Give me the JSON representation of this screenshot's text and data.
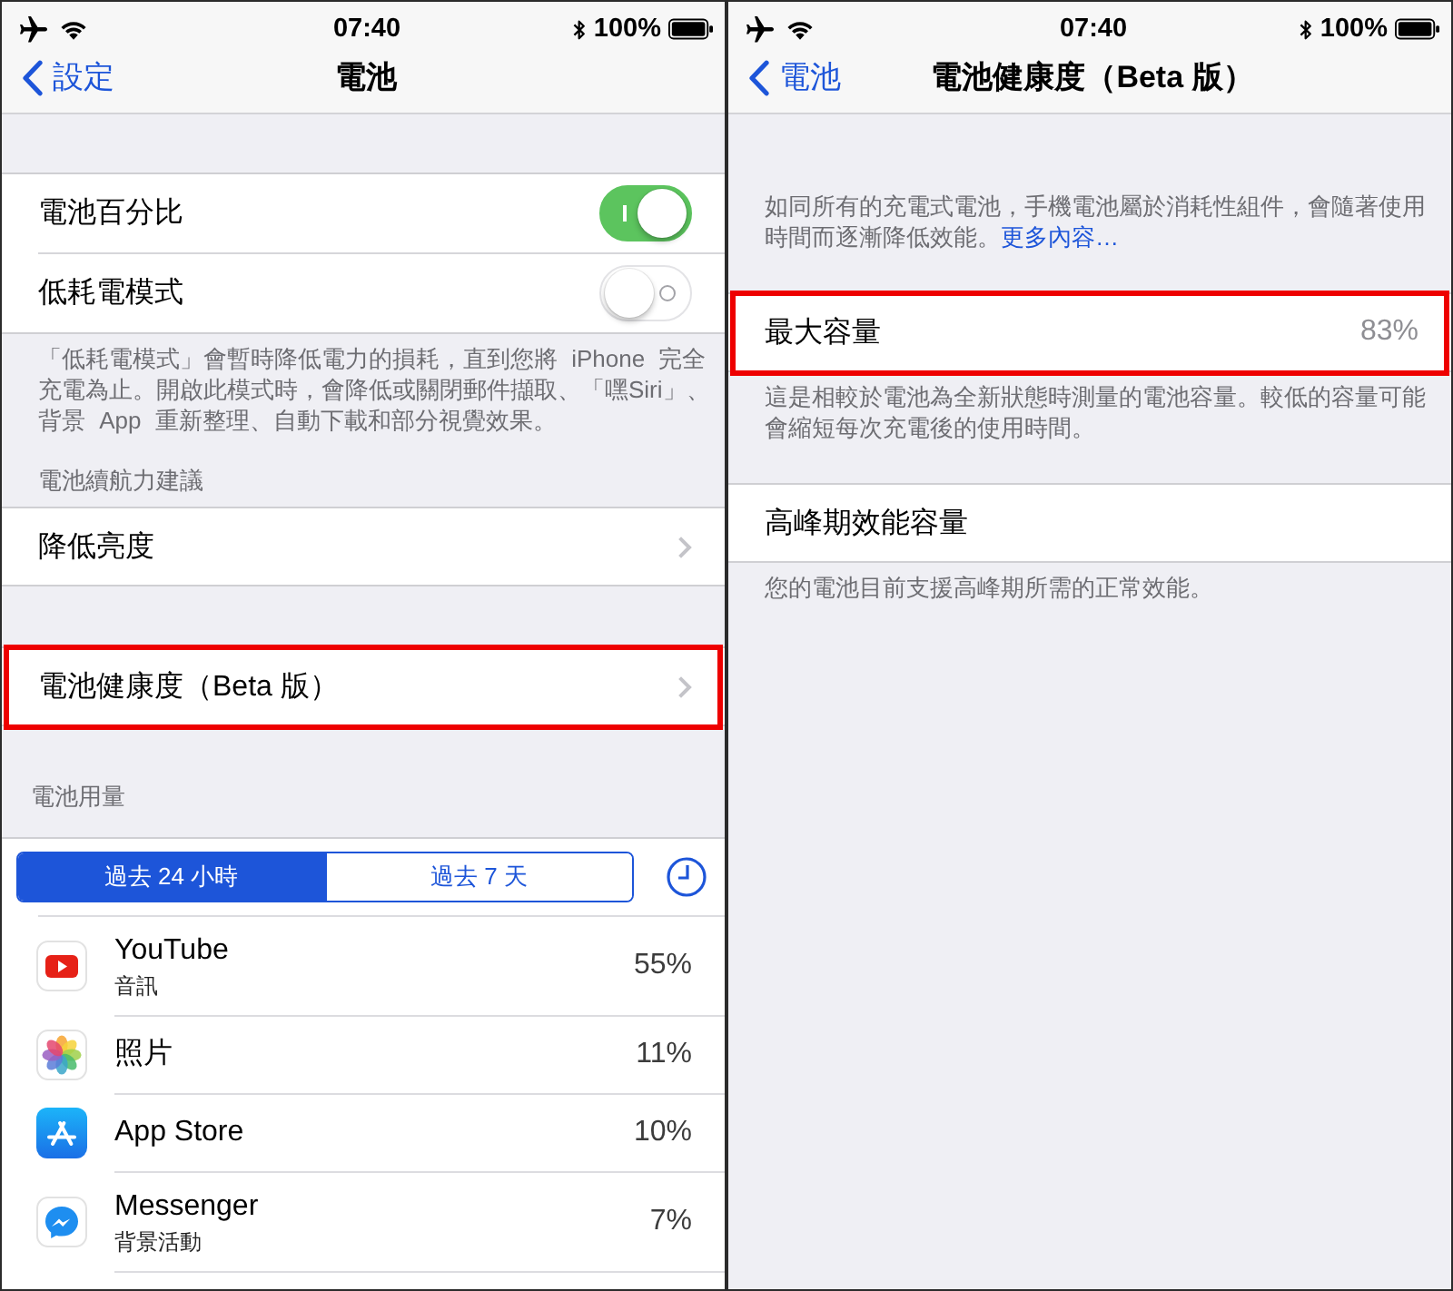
{
  "panels": [
    {
      "status_bar": {
        "time": "07:40",
        "battery": "100%"
      },
      "nav": {
        "back": "設定",
        "title": "電池"
      },
      "blocks": [
        {
          "kind": "group",
          "highlighted": false,
          "rows": [
            {
              "kind": "toggle",
              "label": "電池百分比",
              "on": true
            },
            {
              "kind": "toggle",
              "label": "低耗電模式",
              "on": false
            }
          ]
        },
        {
          "kind": "footer",
          "text": "「低耗電模式」會暫時降低電力的損耗，直到您將 iPhone 完全充電為止。開啟此模式時，會降低或關閉郵件擷取、「嘿Siri」、背景 App 重新整理、自動下載和部分視覺效果。"
        },
        {
          "kind": "header",
          "text": "電池續航力建議"
        },
        {
          "kind": "group",
          "highlighted": false,
          "rows": [
            {
              "kind": "link",
              "label": "降低亮度"
            }
          ]
        },
        {
          "kind": "group",
          "highlighted": true,
          "rows": [
            {
              "kind": "link",
              "label": "電池健康度（Beta 版）"
            }
          ]
        },
        {
          "kind": "header",
          "text": "電池用量"
        },
        {
          "kind": "usage",
          "tabs": [
            {
              "label": "過去 24 小時",
              "selected": true
            },
            {
              "label": "過去 7 天",
              "selected": false
            }
          ],
          "apps": [
            {
              "name": "YouTube",
              "detail": "音訊",
              "percent": "55%"
            },
            {
              "name": "照片",
              "percent": "11%"
            },
            {
              "name": "App Store",
              "percent": "10%"
            },
            {
              "name": "Messenger",
              "detail": "背景活動",
              "percent": "7%"
            }
          ]
        }
      ]
    },
    {
      "status_bar": {
        "time": "07:40",
        "battery": "100%"
      },
      "nav": {
        "back": "電池",
        "title": "電池健康度（Beta 版）"
      },
      "blocks": [
        {
          "kind": "footer",
          "text": "如同所有的充電式電池，手機電池屬於消耗性組件，會隨著使用時間而逐漸降低效能。",
          "link": "更多內容…"
        },
        {
          "kind": "group",
          "highlighted": true,
          "rows": [
            {
              "kind": "value",
              "label": "最大容量",
              "value": "83%"
            }
          ]
        },
        {
          "kind": "footer",
          "text": "這是相較於電池為全新狀態時測量的電池容量。較低的容量可能會縮短每次充電後的使用時間。"
        },
        {
          "kind": "group",
          "highlighted": false,
          "rows": [
            {
              "kind": "plain",
              "label": "高峰期效能容量"
            }
          ]
        },
        {
          "kind": "footer",
          "text": "您的電池目前支援高峰期所需的正常效能。"
        }
      ]
    }
  ]
}
